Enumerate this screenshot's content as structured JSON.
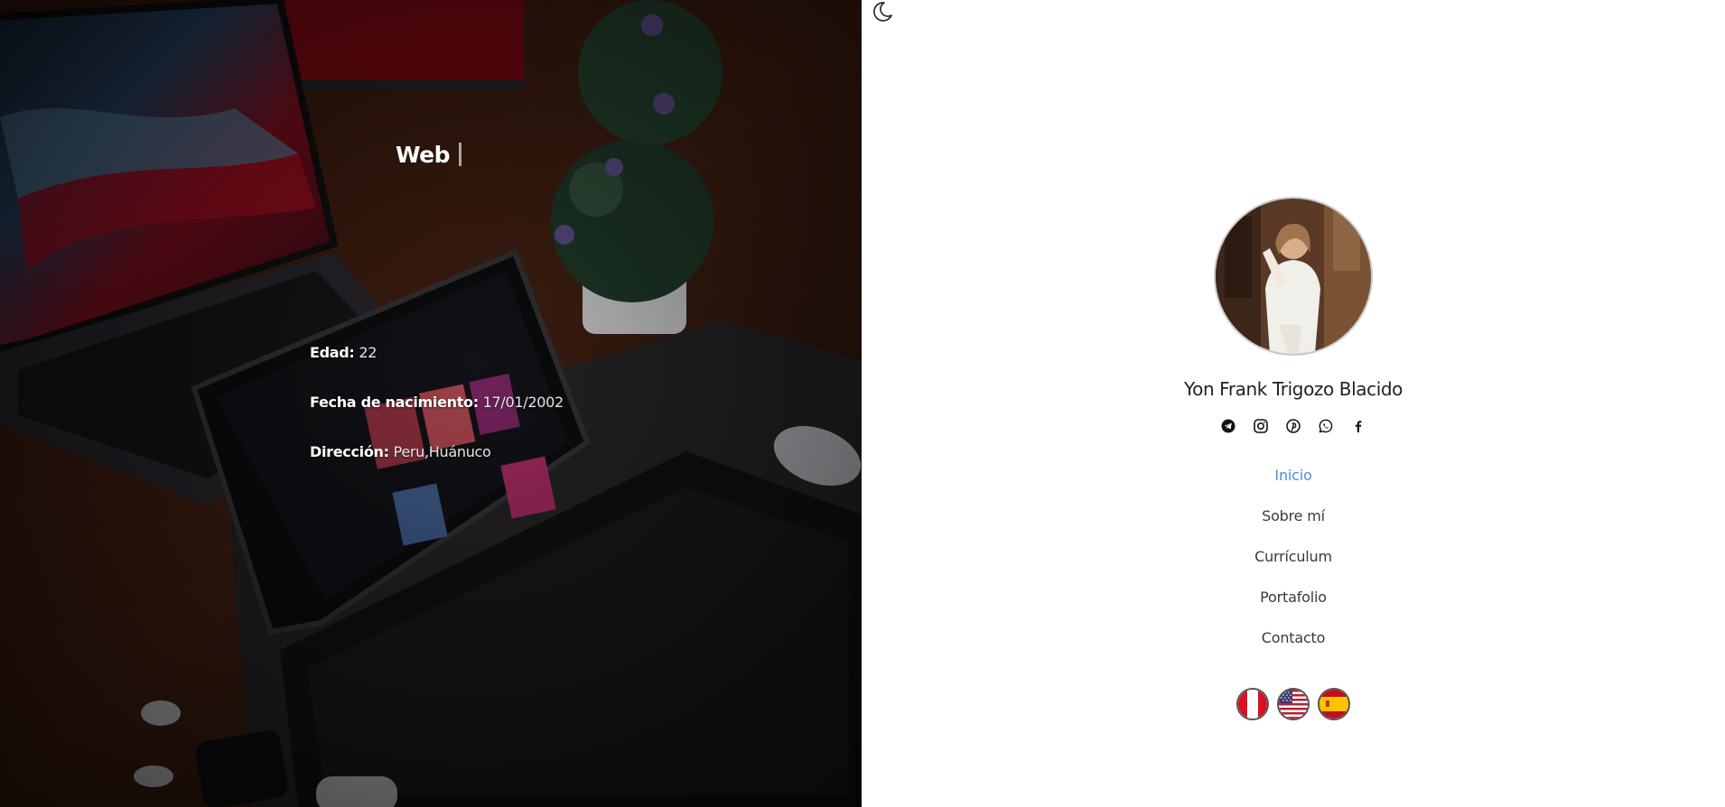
{
  "hero": {
    "title": "Web",
    "info": {
      "age_label": "Edad:",
      "age_value": "22",
      "birth_label": "Fecha de nacimiento:",
      "birth_value": "17/01/2002",
      "address_label": "Dirección:",
      "address_value": "Peru,Huánuco"
    }
  },
  "profile": {
    "name": "Yon Frank Trigozo Blacido"
  },
  "socials": [
    "telegram-icon",
    "instagram-icon",
    "pinterest-icon",
    "whatsapp-icon",
    "facebook-icon"
  ],
  "nav": {
    "items": [
      {
        "label": "Inicio"
      },
      {
        "label": "Sobre mí"
      },
      {
        "label": "Currículum"
      },
      {
        "label": "Portafolio"
      },
      {
        "label": "Contacto"
      }
    ],
    "active": "Inicio"
  },
  "languages": [
    "peru-flag-icon",
    "usa-flag-icon",
    "spain-flag-icon"
  ],
  "colors": {
    "accent": "#4a90d9",
    "text": "#222222",
    "nav_text": "#3a3a3a"
  }
}
